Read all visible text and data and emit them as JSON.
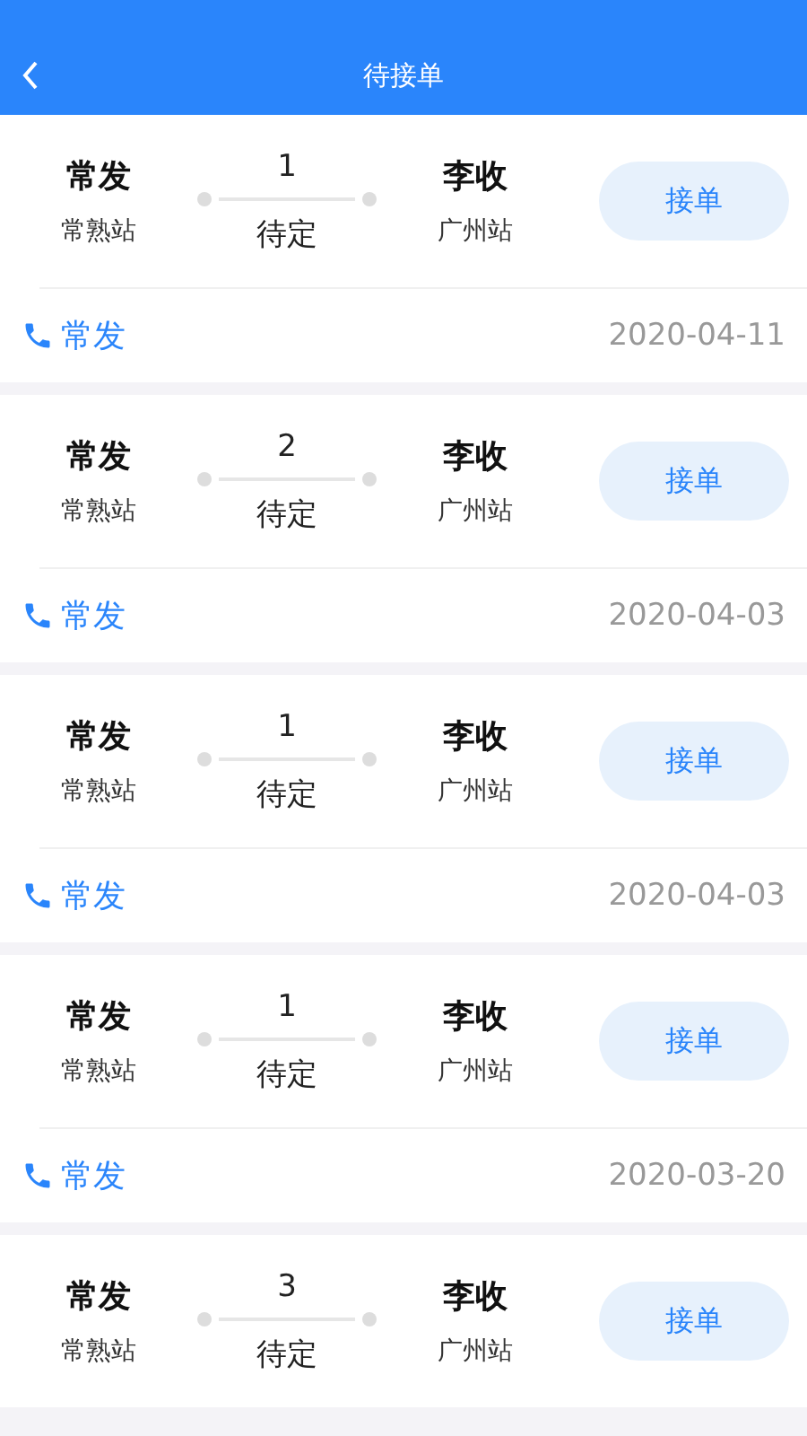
{
  "header": {
    "title": "待接单"
  },
  "orders": [
    {
      "sender": "常发",
      "from_station": "常熟站",
      "count": "1",
      "status": "待定",
      "receiver": "李收",
      "to_station": "广州站",
      "action": "接单",
      "contact": "常发",
      "date": "2020-04-11"
    },
    {
      "sender": "常发",
      "from_station": "常熟站",
      "count": "2",
      "status": "待定",
      "receiver": "李收",
      "to_station": "广州站",
      "action": "接单",
      "contact": "常发",
      "date": "2020-04-03"
    },
    {
      "sender": "常发",
      "from_station": "常熟站",
      "count": "1",
      "status": "待定",
      "receiver": "李收",
      "to_station": "广州站",
      "action": "接单",
      "contact": "常发",
      "date": "2020-04-03"
    },
    {
      "sender": "常发",
      "from_station": "常熟站",
      "count": "1",
      "status": "待定",
      "receiver": "李收",
      "to_station": "广州站",
      "action": "接单",
      "contact": "常发",
      "date": "2020-03-20"
    },
    {
      "sender": "常发",
      "from_station": "常熟站",
      "count": "3",
      "status": "待定",
      "receiver": "李收",
      "to_station": "广州站",
      "action": "接单"
    }
  ]
}
